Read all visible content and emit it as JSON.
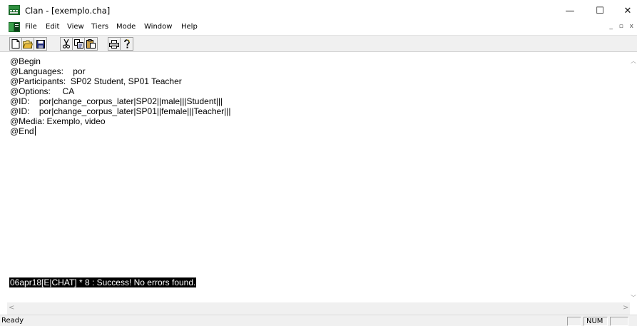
{
  "window": {
    "title": "Clan - [exemplo.cha]",
    "minimize": "—",
    "maximize": "☐",
    "close": "✕"
  },
  "menu": {
    "items": [
      "File",
      "Edit",
      "View",
      "Tiers",
      "Mode",
      "Window",
      "Help"
    ],
    "mdi_controls": "_ ▫ x"
  },
  "toolbar": {
    "buttons": [
      "new-file",
      "open-file",
      "save-file",
      "cut",
      "copy",
      "paste",
      "print",
      "help"
    ]
  },
  "editor": {
    "lines": [
      "@Begin",
      "@Languages:    por",
      "@Participants:  SP02 Student, SP01 Teacher",
      "@Options:     CA",
      "@ID:    por|change_corpus_later|SP02||male|||Student|||",
      "@ID:    por|change_corpus_later|SP01||female|||Teacher|||",
      "@Media: Exemplo, video",
      "@End"
    ],
    "status_message": "06apr18[E|CHAT] * 8 : Success! No errors found."
  },
  "statusbar": {
    "ready": "Ready",
    "num": "NUM"
  },
  "colors": {
    "toolbar_bg": "#f0f0f0",
    "status_highlight_bg": "#000000",
    "status_highlight_fg": "#ffffff"
  }
}
